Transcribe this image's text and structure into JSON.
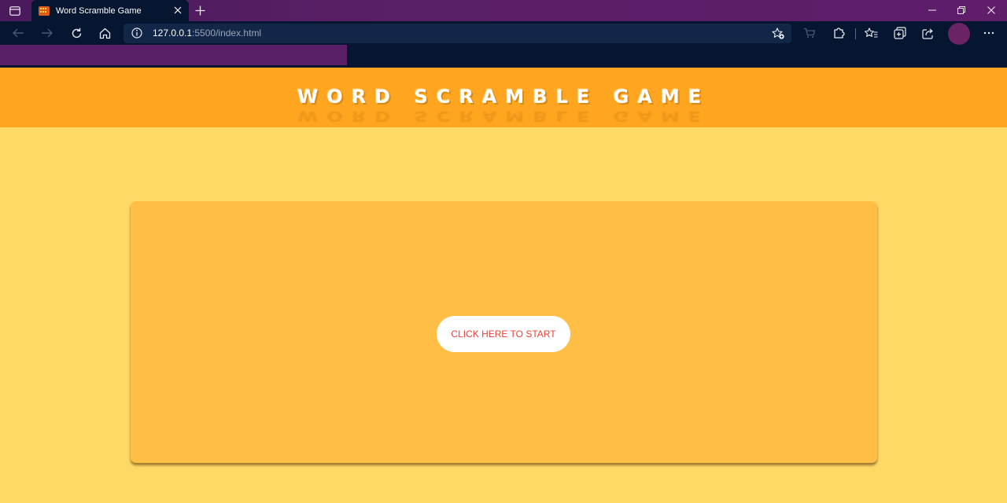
{
  "browser": {
    "tab": {
      "title": "Word Scramble Game",
      "favicon_icon": "word-scramble-favicon-icon"
    },
    "address": {
      "host": "127.0.0.1",
      "path": ":5500/index.html"
    },
    "colors": {
      "titlebar": "#5a1f66",
      "toolbar": "#061530",
      "addressbar": "#122648",
      "avatar": "#6a2364"
    },
    "icons": {
      "tab_actions": "tab-actions-icon",
      "tab_close": "close-icon",
      "new_tab": "plus-icon",
      "minimize": "minimize-icon",
      "restore": "restore-icon",
      "close_window": "close-window-icon",
      "back": "back-arrow-icon",
      "forward": "forward-arrow-icon",
      "refresh": "refresh-icon",
      "home": "home-icon",
      "site_info": "info-icon",
      "add_favorite": "add-favorite-icon",
      "shopping": "shopping-cart-icon",
      "extensions": "extensions-icon",
      "favorites": "favorites-icon",
      "collections": "collections-icon",
      "share": "share-icon",
      "more": "more-icon"
    }
  },
  "page": {
    "header": {
      "title": "WORD SCRAMBLE GAME"
    },
    "start_button": {
      "label": "CLICK HERE TO START"
    },
    "colors": {
      "background": "#ffd966",
      "header": "#ffa51f",
      "card": "#ffbf47",
      "button_text": "#e4433a"
    }
  }
}
